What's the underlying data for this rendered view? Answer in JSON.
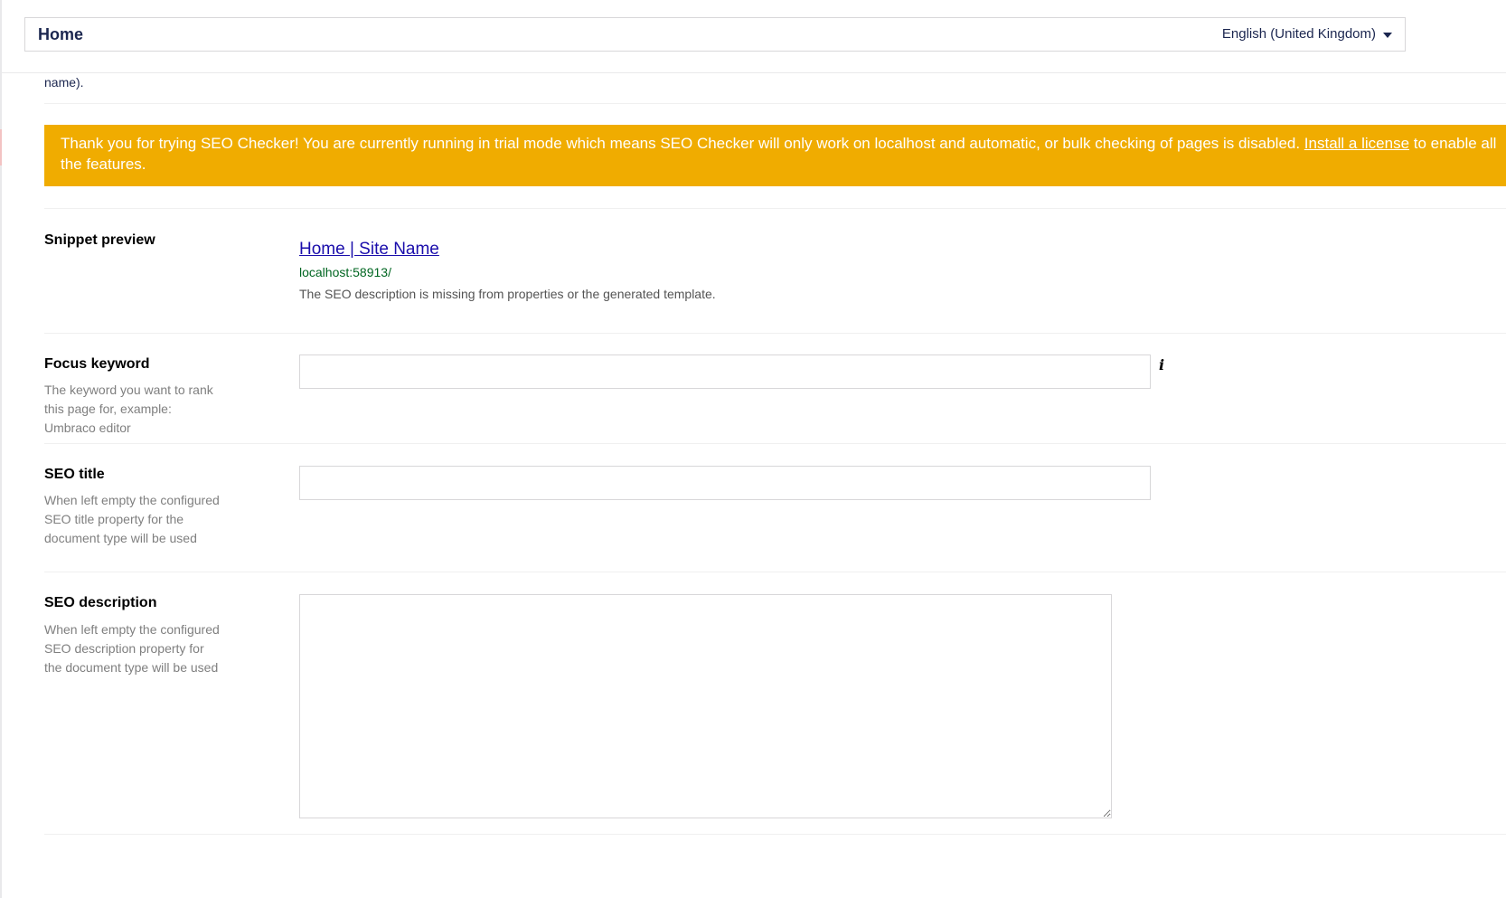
{
  "header": {
    "page_name": "Home",
    "language": "English (United Kingdom)"
  },
  "top_fragment": "name).",
  "trial_banner": {
    "text": "Thank you for trying SEO Checker! You are currently running in trial mode which means SEO Checker will only work on localhost and automatic, or bulk checking of pages is disabled. ",
    "link_text": "Install a license",
    "text_after": " to enable all",
    "line2": "the features.",
    "color": "#f0ac00"
  },
  "snippet": {
    "label": "Snippet preview",
    "title": "Home | Site Name",
    "url": "localhost:58913/",
    "description": "The SEO description is missing from properties or the generated template."
  },
  "focus_keyword": {
    "label": "Focus keyword",
    "description": "The keyword you want to rank this page for, example: Umbraco editor",
    "value": "",
    "info_icon": "info-icon"
  },
  "seo_title": {
    "label": "SEO title",
    "description": "When left empty the configured SEO title property for the document type will be used",
    "value": ""
  },
  "seo_description": {
    "label": "SEO description",
    "description": "When left empty the configured SEO description property for the document type will be used",
    "value": ""
  }
}
